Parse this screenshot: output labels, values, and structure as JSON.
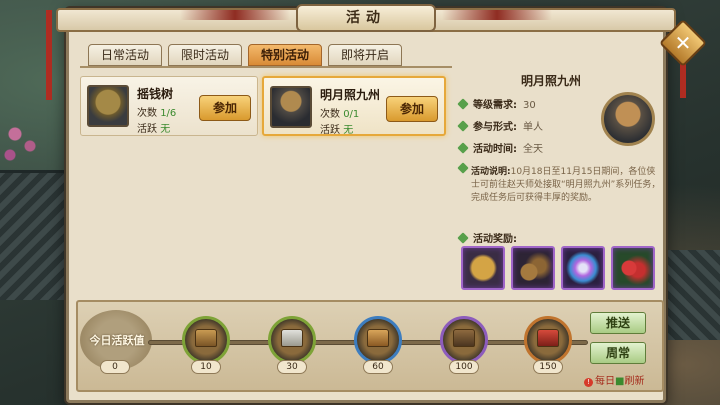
{
  "window": {
    "title": "活动"
  },
  "tabs": [
    {
      "label": "日常活动",
      "active": false
    },
    {
      "label": "限时活动",
      "active": false
    },
    {
      "label": "特别活动",
      "active": true
    },
    {
      "label": "即将开启",
      "active": false
    }
  ],
  "activities": [
    {
      "name": "摇钱树",
      "count_label": "次数",
      "count_value": "1/6",
      "active_label": "活跃",
      "active_value": "无",
      "join_label": "参加",
      "icon": "money-tree-icon"
    },
    {
      "name": "明月照九州",
      "count_label": "次数",
      "count_value": "0/1",
      "active_label": "活跃",
      "active_value": "无",
      "join_label": "参加",
      "icon": "straw-hat-warrior-icon",
      "selected": true
    }
  ],
  "detail": {
    "name": "明月照九州",
    "level_label": "等级需求:",
    "level_value": "30",
    "form_label": "参与形式:",
    "form_value": "单人",
    "time_label": "活动时间:",
    "time_value": "全天",
    "desc_label": "活动说明:",
    "desc_value": "10月18日至11月15日期间，各位侠士可前往赵天师处接取“明月照九州”系列任务，完成任务后可获得丰厚的奖励。",
    "rewards_label": "活动奖励:",
    "rewards": [
      "秘籍",
      "铜钱",
      "宝石",
      "红果"
    ]
  },
  "progress": {
    "label": "今日活跃值",
    "current": "0",
    "milestones": [
      "10",
      "30",
      "60",
      "100",
      "150"
    ],
    "push_label": "推送",
    "weekly_label": "周常",
    "refresh_prefix": "每日",
    "refresh_suffix": "刷新"
  },
  "colors": {
    "accent": "#e6a83a",
    "panel": "#e9dfca",
    "green": "#3b8a2e",
    "reward_border": "#a066c9"
  }
}
